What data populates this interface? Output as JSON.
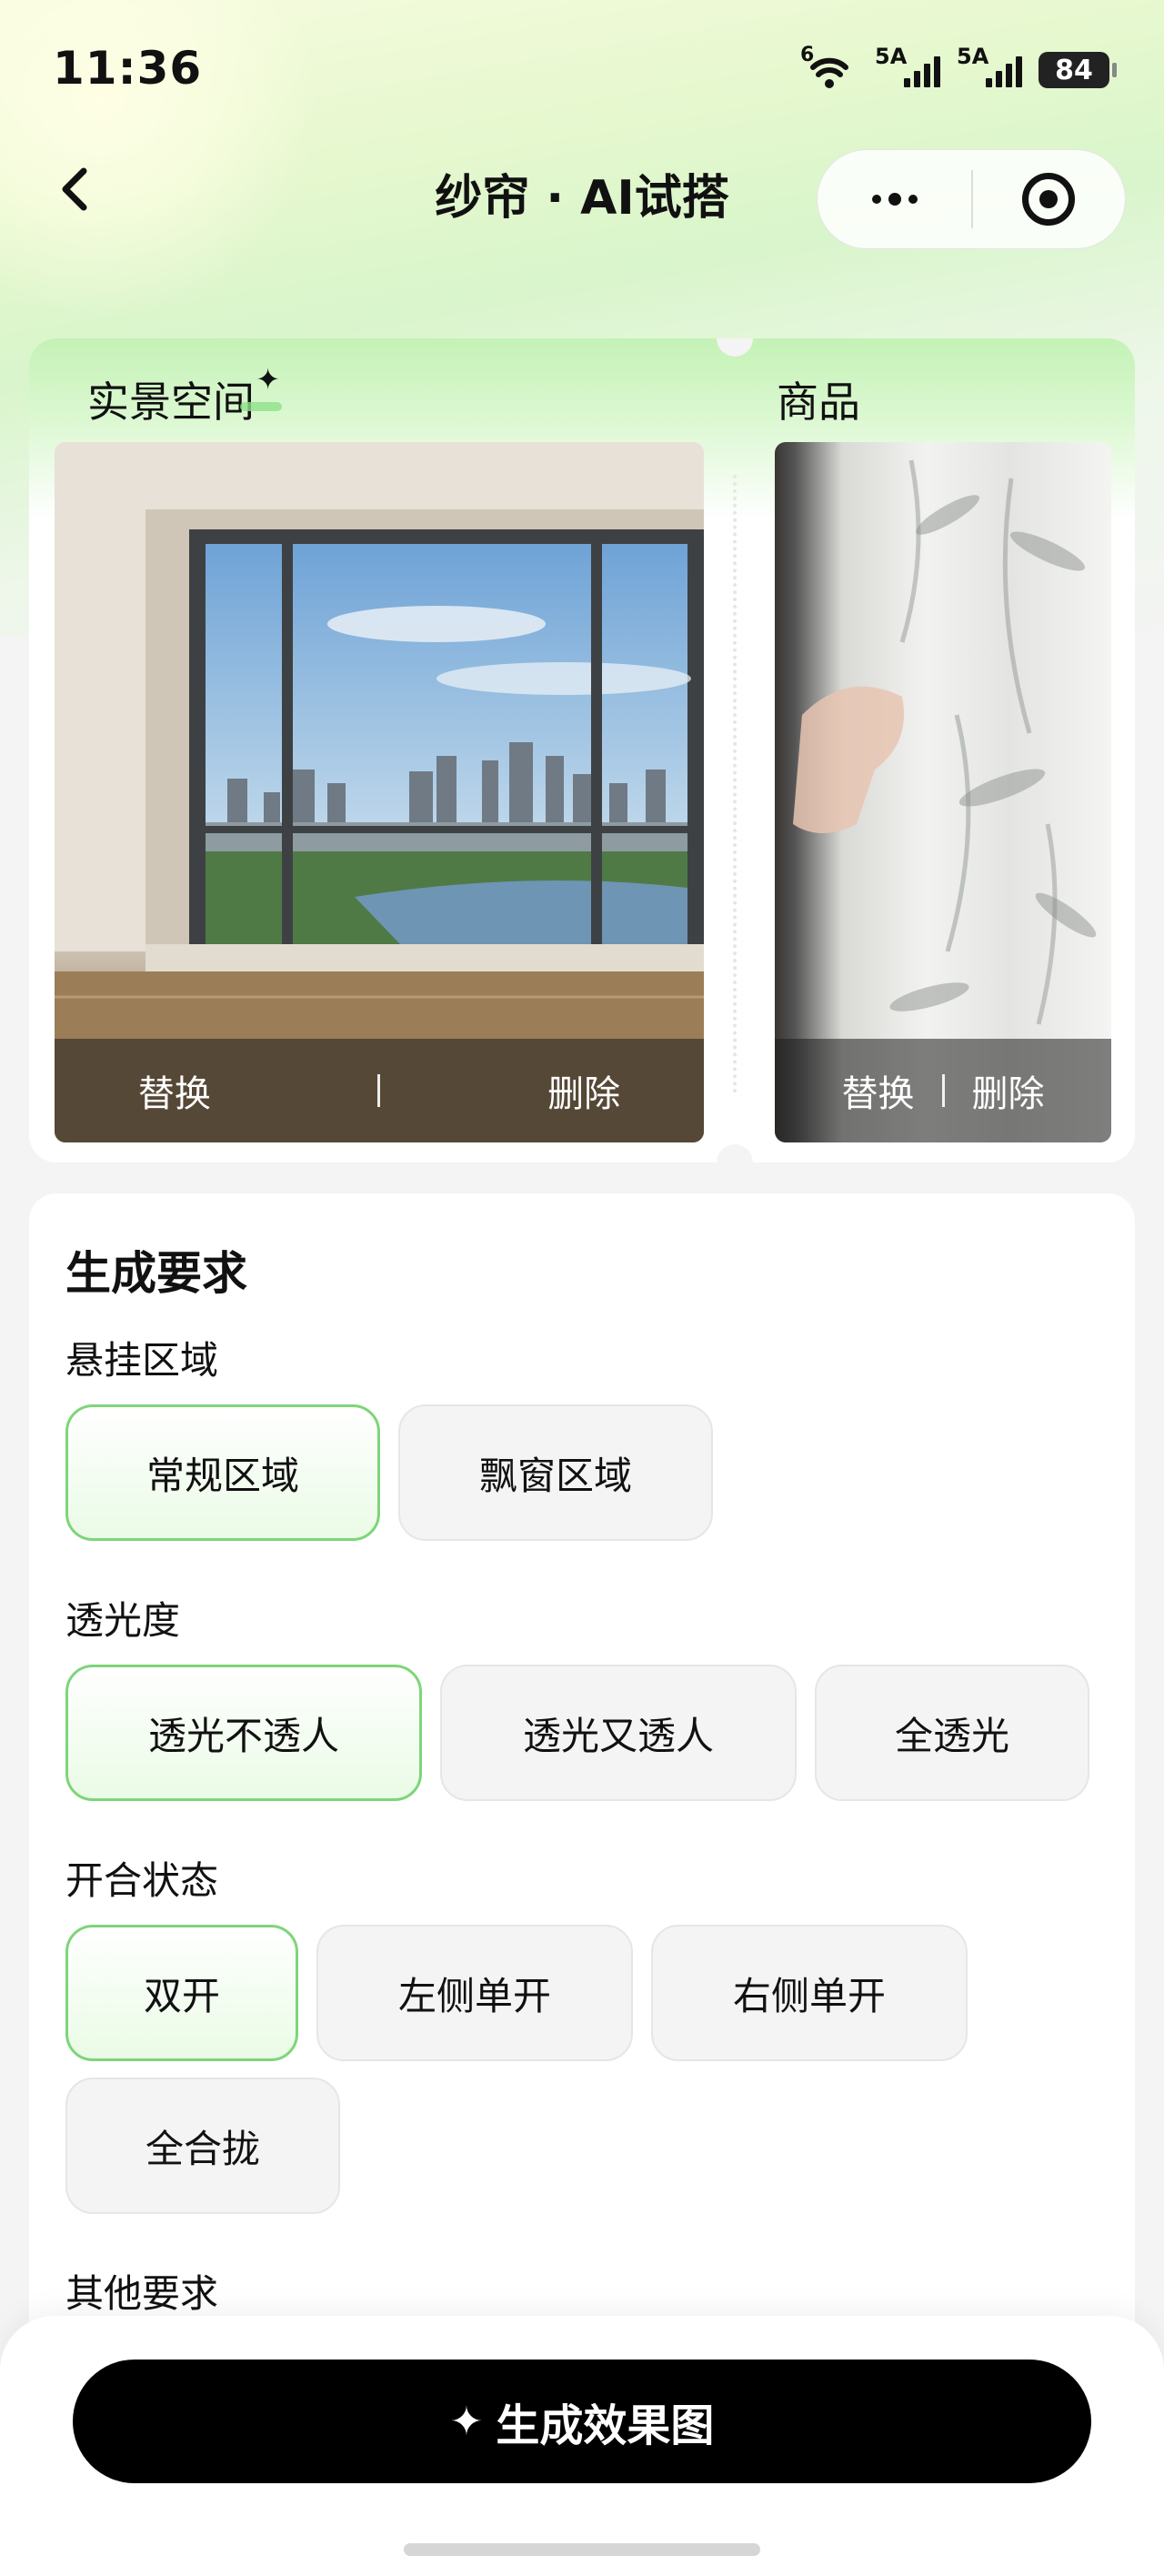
{
  "status_bar": {
    "time": "11:36",
    "wifi_label": "6",
    "signal1_label": "5A",
    "signal2_label": "5A",
    "battery": "84"
  },
  "nav": {
    "title": "纱帘 · AI试搭",
    "back_icon": "chevron-left-icon",
    "more_icon": "more-dots-icon",
    "close_icon": "target-circle-icon"
  },
  "scene": {
    "scene_label": "实景空间",
    "goods_label": "商品",
    "room_actions": {
      "replace": "替换",
      "delete": "删除"
    },
    "goods_actions": {
      "replace": "替换",
      "delete": "删除"
    }
  },
  "requirements": {
    "title": "生成要求",
    "hang_area": {
      "label": "悬挂区域",
      "options": [
        "常规区域",
        "飘窗区域"
      ],
      "selected": "常规区域"
    },
    "transparency": {
      "label": "透光度",
      "options": [
        "透光不透人",
        "透光又透人",
        "全透光"
      ],
      "selected": "透光不透人"
    },
    "open_state": {
      "label": "开合状态",
      "options": [
        "双开",
        "左侧单开",
        "右侧单开",
        "全合拢"
      ],
      "selected": "双开"
    },
    "other_label": "其他要求"
  },
  "bottom": {
    "generate_label": "生成效果图"
  },
  "colors": {
    "accent_green": "#7ed57a",
    "button_black": "#000000"
  }
}
